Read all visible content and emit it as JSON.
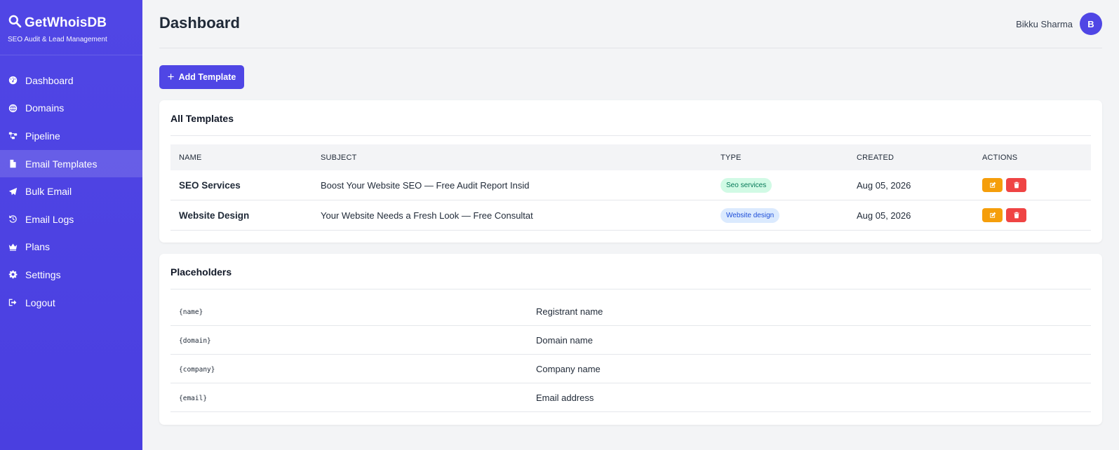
{
  "brand": {
    "title": "GetWhoisDB",
    "subtitle": "SEO Audit & Lead Management",
    "icon": "search-icon"
  },
  "sidebar": {
    "items": [
      {
        "label": "Dashboard",
        "icon": "gauge-icon",
        "active": false
      },
      {
        "label": "Domains",
        "icon": "globe-icon",
        "active": false
      },
      {
        "label": "Pipeline",
        "icon": "pipeline-icon",
        "active": false
      },
      {
        "label": "Email Templates",
        "icon": "file-icon",
        "active": true
      },
      {
        "label": "Bulk Email",
        "icon": "paper-plane-icon",
        "active": false
      },
      {
        "label": "Email Logs",
        "icon": "history-icon",
        "active": false
      },
      {
        "label": "Plans",
        "icon": "crown-icon",
        "active": false
      },
      {
        "label": "Settings",
        "icon": "gear-icon",
        "active": false
      },
      {
        "label": "Logout",
        "icon": "logout-icon",
        "active": false
      }
    ]
  },
  "header": {
    "title": "Dashboard",
    "user_name": "Bikku Sharma",
    "avatar_initial": "B"
  },
  "toolbar": {
    "add_label": "Add Template"
  },
  "templates": {
    "title": "All Templates",
    "columns": [
      "NAME",
      "SUBJECT",
      "TYPE",
      "CREATED",
      "ACTIONS"
    ],
    "rows": [
      {
        "name": "SEO Services",
        "subject": "Boost Your Website SEO — Free Audit Report Insid",
        "type": "Seo services",
        "type_color": "green",
        "created": "Aug 05, 2026"
      },
      {
        "name": "Website Design",
        "subject": "Your Website Needs a Fresh Look — Free Consultat",
        "type": "Website design",
        "type_color": "blue",
        "created": "Aug 05, 2026"
      }
    ]
  },
  "placeholders": {
    "title": "Placeholders",
    "rows": [
      {
        "code": "{name}",
        "description": "Registrant name"
      },
      {
        "code": "{domain}",
        "description": "Domain name"
      },
      {
        "code": "{company}",
        "description": "Company name"
      },
      {
        "code": "{email}",
        "description": "Email address"
      }
    ]
  },
  "colors": {
    "sidebar": "#4f46e5",
    "primary": "#4f46e5",
    "edit": "#f59e0b",
    "delete": "#ef4444"
  }
}
